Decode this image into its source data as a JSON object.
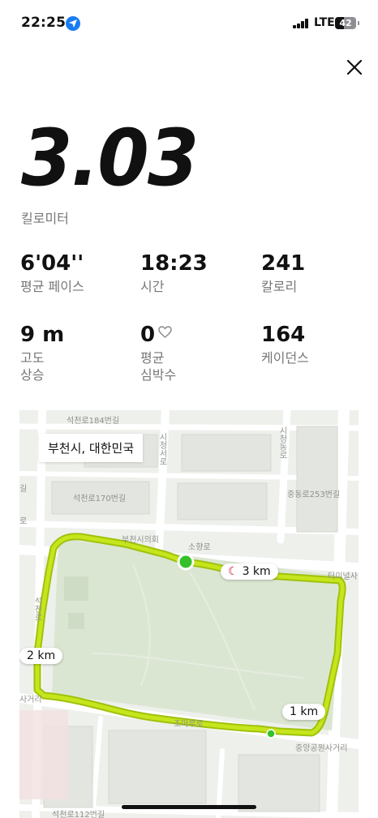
{
  "status_bar": {
    "time": "22:25",
    "network": "LTE",
    "battery": "42",
    "icons": [
      "location-arrow-icon",
      "cellular-signal-icon",
      "battery-icon"
    ]
  },
  "header": {
    "close_icon": "close-icon"
  },
  "summary": {
    "distance_value": "3.03",
    "distance_unit": "킬로미터"
  },
  "stats": [
    {
      "value": "6'04''",
      "label": "평균 페이스"
    },
    {
      "value": "18:23",
      "label": "시간"
    },
    {
      "value": "241",
      "label": "칼로리"
    },
    {
      "value": "9 m",
      "label_line1": "고도",
      "label_line2": "상승"
    },
    {
      "value": "0",
      "label_line1": "평균",
      "label_line2": "심박수",
      "icon": "heart-outline-icon"
    },
    {
      "value": "164",
      "label": "케이던스"
    }
  ],
  "map": {
    "city_label": "부천시, 대한민국",
    "markers": {
      "km1": "1 km",
      "km2": "2 km",
      "km3": "3 km"
    },
    "streets": {
      "s184": "석천로184번길",
      "s170": "석천로170번길",
      "city_hall": "부천시의회",
      "sohyang": "소향로",
      "terminal": "터미널사",
      "jungdong253": "중동로253번길",
      "sicheong": "시청서로",
      "sicheong_e": "시청동로",
      "seokcheon": "석천로",
      "gil1": "길",
      "ro1": "로",
      "sageori": "사거리",
      "jomaru": "조마루로",
      "central_park": "중앙공원사거리",
      "s112": "석천로112번길"
    },
    "colors": {
      "route": "#c6e51c",
      "route_dark": "#9fc20c",
      "start_dot": "#35c12a",
      "park": "#dbe6d2"
    }
  }
}
